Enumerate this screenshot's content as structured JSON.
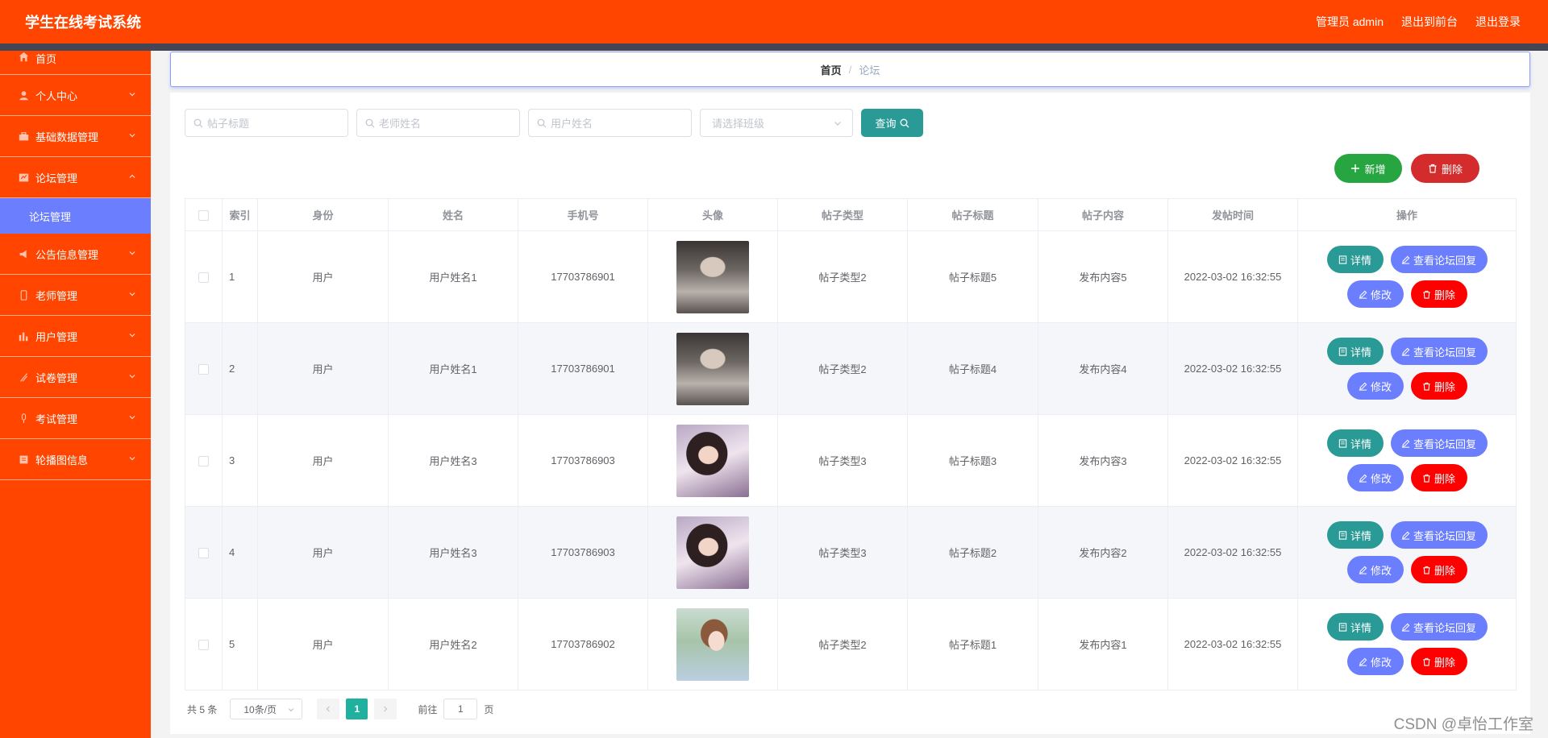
{
  "header": {
    "title": "学生在线考试系统",
    "admin_label": "管理员 admin",
    "front_label": "退出到前台",
    "logout_label": "退出登录"
  },
  "sidebar": {
    "items": [
      {
        "label": "首页",
        "icon": "home-icon"
      },
      {
        "label": "个人中心",
        "icon": "user-icon"
      },
      {
        "label": "基础数据管理",
        "icon": "briefcase-icon"
      },
      {
        "label": "论坛管理",
        "icon": "forum-icon"
      },
      {
        "label": "公告信息管理",
        "icon": "notice-icon"
      },
      {
        "label": "老师管理",
        "icon": "phone-icon"
      },
      {
        "label": "用户管理",
        "icon": "chart-icon"
      },
      {
        "label": "试卷管理",
        "icon": "paper-icon"
      },
      {
        "label": "考试管理",
        "icon": "mic-icon"
      },
      {
        "label": "轮播图信息",
        "icon": "carousel-icon"
      }
    ],
    "active_submenu": "论坛管理"
  },
  "breadcrumb": {
    "home": "首页",
    "separator": "/",
    "current": "论坛"
  },
  "search": {
    "title_placeholder": "帖子标题",
    "teacher_placeholder": "老师姓名",
    "user_placeholder": "用户姓名",
    "class_placeholder": "请选择班级",
    "query_label": "查询"
  },
  "toolbar": {
    "add_label": "新增",
    "delete_label": "删除"
  },
  "table": {
    "columns": [
      "",
      "索引",
      "身份",
      "姓名",
      "手机号",
      "头像",
      "帖子类型",
      "帖子标题",
      "帖子内容",
      "发帖时间",
      "操作"
    ],
    "rows": [
      {
        "index": "1",
        "role": "用户",
        "name": "用户姓名1",
        "phone": "17703786901",
        "avatar": "man-portrait",
        "type": "帖子类型2",
        "title": "帖子标题5",
        "content": "发布内容5",
        "time": "2022-03-02 16:32:55"
      },
      {
        "index": "2",
        "role": "用户",
        "name": "用户姓名1",
        "phone": "17703786901",
        "avatar": "man-portrait",
        "type": "帖子类型2",
        "title": "帖子标题4",
        "content": "发布内容4",
        "time": "2022-03-02 16:32:55"
      },
      {
        "index": "3",
        "role": "用户",
        "name": "用户姓名3",
        "phone": "17703786903",
        "avatar": "woman-portrait",
        "type": "帖子类型3",
        "title": "帖子标题3",
        "content": "发布内容3",
        "time": "2022-03-02 16:32:55"
      },
      {
        "index": "4",
        "role": "用户",
        "name": "用户姓名3",
        "phone": "17703786903",
        "avatar": "woman-portrait",
        "type": "帖子类型3",
        "title": "帖子标题2",
        "content": "发布内容2",
        "time": "2022-03-02 16:32:55"
      },
      {
        "index": "5",
        "role": "用户",
        "name": "用户姓名2",
        "phone": "17703786902",
        "avatar": "girl-portrait",
        "type": "帖子类型2",
        "title": "帖子标题1",
        "content": "发布内容1",
        "time": "2022-03-02 16:32:55"
      }
    ],
    "actions": {
      "detail": "详情",
      "reply": "查看论坛回复",
      "edit": "修改",
      "delete": "删除"
    }
  },
  "pagination": {
    "total_label": "共 5 条",
    "page_size": "10条/页",
    "current_page": "1",
    "goto_label": "前往",
    "goto_value": "1",
    "page_suffix": "页"
  },
  "watermark": "CSDN @卓怡工作室",
  "colors": {
    "header": "#ff4500",
    "sidebar": "#ff4500",
    "submenu_active": "#6a7efe",
    "teal": "#2a9a96",
    "green": "#27a540",
    "red": "#d42c2c",
    "delete_red": "#ff0000",
    "page_active": "#1fb19e"
  }
}
